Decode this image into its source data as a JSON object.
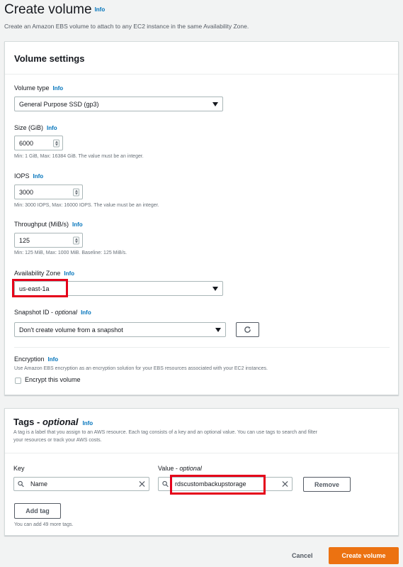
{
  "page": {
    "title": "Create volume",
    "title_info": "Info",
    "description": "Create an Amazon EBS volume to attach to any EC2 instance in the same Availability Zone."
  },
  "volume_settings": {
    "title": "Volume settings",
    "volume_type": {
      "label": "Volume type",
      "info": "Info",
      "value": "General Purpose SSD (gp3)"
    },
    "size": {
      "label": "Size (GiB)",
      "info": "Info",
      "value": "6000",
      "hint": "Min: 1 GiB, Max: 16384 GiB. The value must be an integer."
    },
    "iops": {
      "label": "IOPS",
      "info": "Info",
      "value": "3000",
      "hint": "Min: 3000 IOPS, Max: 16000 IOPS. The value must be an integer."
    },
    "throughput": {
      "label": "Throughput (MiB/s)",
      "info": "Info",
      "value": "125",
      "hint": "Min: 125 MiB, Max: 1000 MiB. Baseline: 125 MiB/s."
    },
    "availability_zone": {
      "label": "Availability Zone",
      "info": "Info",
      "value": "us-east-1a"
    },
    "snapshot": {
      "label": "Snapshot ID",
      "label_optional": "optional",
      "info": "Info",
      "value": "Don't create volume from a snapshot"
    },
    "encryption": {
      "label": "Encryption",
      "info": "Info",
      "description": "Use Amazon EBS encryption as an encryption solution for your EBS resources associated with your EC2 instances.",
      "checkbox_label": "Encrypt this volume",
      "checked": false
    }
  },
  "tags": {
    "title": "Tags",
    "title_optional": "optional",
    "info": "Info",
    "description_line1": "A tag is a label that you assign to an AWS resource. Each tag consists of a key and an optional value. You can use tags to search and filter",
    "description_line2": "your resources or track your AWS costs.",
    "key_label": "Key",
    "value_label": "Value",
    "value_optional": "optional",
    "rows": [
      {
        "key": "Name",
        "value": "rdscustombackupstorage",
        "remove_label": "Remove"
      }
    ],
    "add_tag_label": "Add tag",
    "remaining_hint": "You can add 49 more tags."
  },
  "footer": {
    "cancel_label": "Cancel",
    "create_label": "Create volume"
  },
  "colors": {
    "primary_button": "#ec7211",
    "info_link": "#0073bb",
    "highlight": "#e5001a"
  }
}
